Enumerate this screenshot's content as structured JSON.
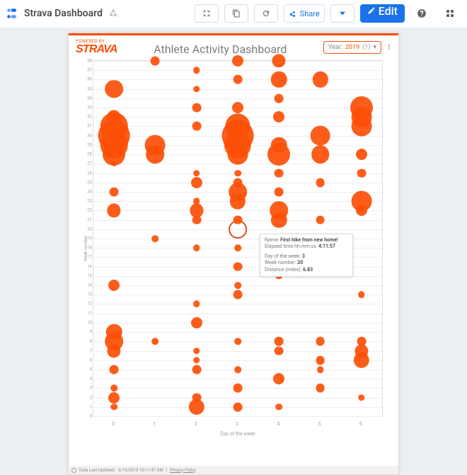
{
  "topbar": {
    "title": "Strava Dashboard",
    "share_label": "Share",
    "edit_label": "Edit"
  },
  "report": {
    "powered_by": "POWERED BY",
    "logo_text": "STRAVA",
    "title": "Athlete Activity Dashboard",
    "year_filter": {
      "label": "Year:",
      "value": "2019",
      "count": "(1)"
    }
  },
  "tooltip": {
    "name_label": "Name:",
    "name_value": "First hike from new home!",
    "elapsed_label": "Elapsed time hh:mm:ss:",
    "elapsed_value": "4:11:57",
    "dow_label": "Day of the week:",
    "dow_value": "3",
    "week_label": "Week number:",
    "week_value": "20",
    "dist_label": "Distance (miles):",
    "dist_value": "6.83"
  },
  "footer": {
    "updated_label": "Data Last Updated:",
    "updated_value": "9/19/2019 10:11:47 AM",
    "privacy": "Privacy Policy"
  },
  "chart_data": {
    "type": "scatter",
    "title": "Athlete Activity Dashboard",
    "xlabel": "Day of the week",
    "ylabel": "Week number",
    "xlim": [
      -0.5,
      6.5
    ],
    "ylim": [
      0,
      38
    ],
    "size_field": "Distance (miles)",
    "points": [
      {
        "x": 0,
        "y": 1,
        "size": 3
      },
      {
        "x": 0,
        "y": 2,
        "size": 5
      },
      {
        "x": 0,
        "y": 3,
        "size": 3
      },
      {
        "x": 0,
        "y": 5,
        "size": 4
      },
      {
        "x": 0,
        "y": 7,
        "size": 6
      },
      {
        "x": 0,
        "y": 8,
        "size": 8
      },
      {
        "x": 0,
        "y": 9,
        "size": 7
      },
      {
        "x": 0,
        "y": 14,
        "size": 5
      },
      {
        "x": 0,
        "y": 22,
        "size": 6
      },
      {
        "x": 0,
        "y": 24,
        "size": 4
      },
      {
        "x": 0,
        "y": 27,
        "size": 2
      },
      {
        "x": 0,
        "y": 28,
        "size": 10
      },
      {
        "x": 0,
        "y": 29,
        "size": 12
      },
      {
        "x": 0,
        "y": 30,
        "size": 14
      },
      {
        "x": 0,
        "y": 31,
        "size": 12
      },
      {
        "x": 0,
        "y": 32,
        "size": 6
      },
      {
        "x": 0,
        "y": 35,
        "size": 8
      },
      {
        "x": 1,
        "y": 8,
        "size": 3
      },
      {
        "x": 1,
        "y": 19,
        "size": 3
      },
      {
        "x": 1,
        "y": 28,
        "size": 8
      },
      {
        "x": 1,
        "y": 29,
        "size": 9
      },
      {
        "x": 1,
        "y": 38,
        "size": 4
      },
      {
        "x": 2,
        "y": 1,
        "size": 7
      },
      {
        "x": 2,
        "y": 2,
        "size": 4
      },
      {
        "x": 2,
        "y": 5,
        "size": 4
      },
      {
        "x": 2,
        "y": 6,
        "size": 3
      },
      {
        "x": 2,
        "y": 7,
        "size": 3
      },
      {
        "x": 2,
        "y": 10,
        "size": 5
      },
      {
        "x": 2,
        "y": 12,
        "size": 3
      },
      {
        "x": 2,
        "y": 18,
        "size": 3
      },
      {
        "x": 2,
        "y": 21,
        "size": 4
      },
      {
        "x": 2,
        "y": 22,
        "size": 6
      },
      {
        "x": 2,
        "y": 23,
        "size": 3
      },
      {
        "x": 2,
        "y": 25,
        "size": 5
      },
      {
        "x": 2,
        "y": 26,
        "size": 3
      },
      {
        "x": 2,
        "y": 31,
        "size": 4
      },
      {
        "x": 2,
        "y": 33,
        "size": 4
      },
      {
        "x": 2,
        "y": 35,
        "size": 3
      },
      {
        "x": 2,
        "y": 37,
        "size": 3
      },
      {
        "x": 3,
        "y": 1,
        "size": 4
      },
      {
        "x": 3,
        "y": 3,
        "size": 4
      },
      {
        "x": 3,
        "y": 5,
        "size": 3
      },
      {
        "x": 3,
        "y": 8,
        "size": 3
      },
      {
        "x": 3,
        "y": 13,
        "size": 4
      },
      {
        "x": 3,
        "y": 14,
        "size": 3
      },
      {
        "x": 3,
        "y": 16,
        "size": 4
      },
      {
        "x": 3,
        "y": 18,
        "size": 3
      },
      {
        "x": 3,
        "y": 20,
        "size": 6.83,
        "sel": true
      },
      {
        "x": 3,
        "y": 21,
        "size": 4
      },
      {
        "x": 3,
        "y": 23,
        "size": 7
      },
      {
        "x": 3,
        "y": 24,
        "size": 8
      },
      {
        "x": 3,
        "y": 25,
        "size": 4
      },
      {
        "x": 3,
        "y": 26,
        "size": 3
      },
      {
        "x": 3,
        "y": 28,
        "size": 9
      },
      {
        "x": 3,
        "y": 29,
        "size": 12
      },
      {
        "x": 3,
        "y": 30,
        "size": 14
      },
      {
        "x": 3,
        "y": 31,
        "size": 11
      },
      {
        "x": 3,
        "y": 33,
        "size": 5
      },
      {
        "x": 3,
        "y": 36,
        "size": 4
      },
      {
        "x": 3,
        "y": 38,
        "size": 5
      },
      {
        "x": 4,
        "y": 1,
        "size": 3
      },
      {
        "x": 4,
        "y": 4,
        "size": 5
      },
      {
        "x": 4,
        "y": 7,
        "size": 4
      },
      {
        "x": 4,
        "y": 8,
        "size": 4
      },
      {
        "x": 4,
        "y": 15,
        "size": 3
      },
      {
        "x": 4,
        "y": 17,
        "size": 4
      },
      {
        "x": 4,
        "y": 21,
        "size": 7
      },
      {
        "x": 4,
        "y": 22,
        "size": 8
      },
      {
        "x": 4,
        "y": 24,
        "size": 4
      },
      {
        "x": 4,
        "y": 26,
        "size": 4
      },
      {
        "x": 4,
        "y": 28,
        "size": 10
      },
      {
        "x": 4,
        "y": 29,
        "size": 7
      },
      {
        "x": 4,
        "y": 32,
        "size": 5
      },
      {
        "x": 4,
        "y": 34,
        "size": 4
      },
      {
        "x": 4,
        "y": 36,
        "size": 7
      },
      {
        "x": 4,
        "y": 38,
        "size": 6
      },
      {
        "x": 5,
        "y": 3,
        "size": 4
      },
      {
        "x": 5,
        "y": 5,
        "size": 3
      },
      {
        "x": 5,
        "y": 6,
        "size": 4
      },
      {
        "x": 5,
        "y": 8,
        "size": 4
      },
      {
        "x": 5,
        "y": 21,
        "size": 4
      },
      {
        "x": 5,
        "y": 25,
        "size": 4
      },
      {
        "x": 5,
        "y": 28,
        "size": 8
      },
      {
        "x": 5,
        "y": 30,
        "size": 9
      },
      {
        "x": 5,
        "y": 36,
        "size": 7
      },
      {
        "x": 6,
        "y": 2,
        "size": 3
      },
      {
        "x": 6,
        "y": 6,
        "size": 7
      },
      {
        "x": 6,
        "y": 7,
        "size": 6
      },
      {
        "x": 6,
        "y": 8,
        "size": 4
      },
      {
        "x": 6,
        "y": 13,
        "size": 3
      },
      {
        "x": 6,
        "y": 22,
        "size": 5
      },
      {
        "x": 6,
        "y": 23,
        "size": 9
      },
      {
        "x": 6,
        "y": 26,
        "size": 4
      },
      {
        "x": 6,
        "y": 28,
        "size": 5
      },
      {
        "x": 6,
        "y": 31,
        "size": 9
      },
      {
        "x": 6,
        "y": 32,
        "size": 9
      },
      {
        "x": 6,
        "y": 33,
        "size": 10
      }
    ]
  }
}
